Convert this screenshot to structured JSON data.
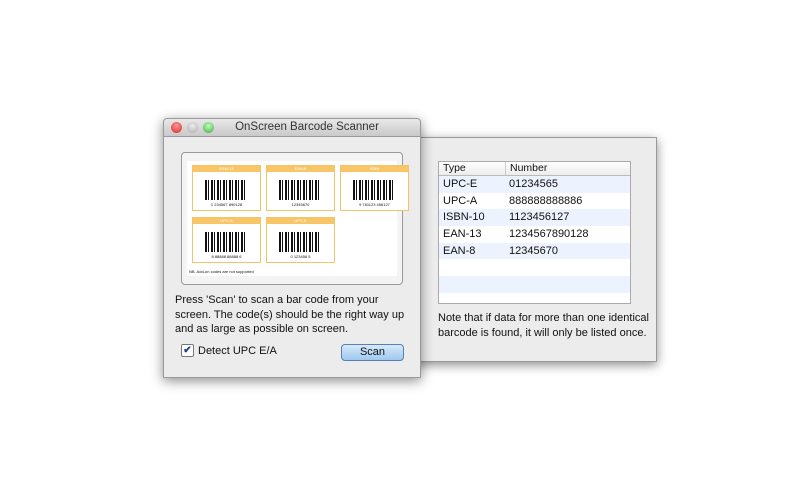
{
  "window": {
    "title": "OnScreen Barcode Scanner"
  },
  "preview": {
    "cards": [
      {
        "label": "EAN-13",
        "digits": "1 234567 890128"
      },
      {
        "label": "EAN-8",
        "digits": "12345670"
      },
      {
        "label": "ISBN",
        "digits": "9 781123 456127"
      },
      {
        "label": "UPC-A",
        "digits": "8 88888 88888 6"
      },
      {
        "label": "UPC-E",
        "digits": "0 123456 5"
      }
    ],
    "footnote": "NB. Add-on codes are not supported"
  },
  "instructions": "Press 'Scan' to scan a bar code from your screen. The code(s) should be the right way up and as large as possible on screen.",
  "detect_checkbox": {
    "label": "Detect UPC E/A",
    "checked": true
  },
  "scan_button": "Scan",
  "results": {
    "columns": [
      "Type",
      "Number"
    ],
    "rows": [
      [
        "UPC-E",
        "01234565"
      ],
      [
        "UPC-A",
        "888888888886"
      ],
      [
        "ISBN-10",
        "1123456127"
      ],
      [
        "EAN-13",
        "1234567890128"
      ],
      [
        "EAN-8",
        "12345670"
      ]
    ]
  },
  "note": "Note that if data for more than one identical barcode is found, it will only be listed once."
}
